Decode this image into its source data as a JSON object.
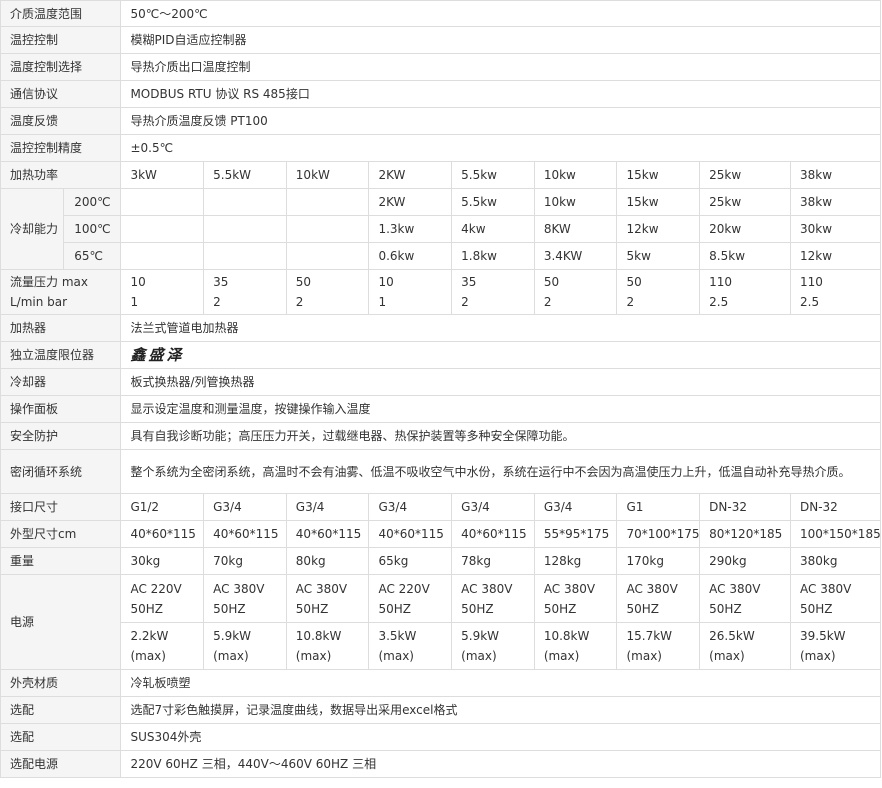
{
  "rows": [
    {
      "label": "介质温度范围",
      "value": "50℃～200℃"
    },
    {
      "label": "温控控制",
      "value": "模糊PID自适应控制器"
    },
    {
      "label": "温度控制选择",
      "value": "导热介质出口温度控制"
    },
    {
      "label": "通信协议",
      "value": "MODBUS RTU 协议  RS 485接口"
    },
    {
      "label": "温度反馈",
      "value": "导热介质温度反馈 PT100"
    },
    {
      "label": "温控控制精度",
      "value": "±0.5℃"
    }
  ],
  "heating_power": {
    "label": "加热功率",
    "values": [
      "3kW",
      "5.5kW",
      "10kW",
      "2KW",
      "5.5kw",
      "10kw",
      "15kw",
      "25kw",
      "38kw"
    ]
  },
  "cooling": {
    "label": "冷却能力",
    "rows": [
      {
        "temp": "200℃",
        "values": [
          "",
          "",
          "",
          "2KW",
          "5.5kw",
          "10kw",
          "15kw",
          "25kw",
          "38kw"
        ]
      },
      {
        "temp": "100℃",
        "values": [
          "",
          "",
          "",
          "1.3kw",
          "4kw",
          "8KW",
          "12kw",
          "20kw",
          "30kw"
        ]
      },
      {
        "temp": "65℃",
        "values": [
          "",
          "",
          "",
          "0.6kw",
          "1.8kw",
          "3.4KW",
          "5kw",
          "8.5kw",
          "12kw"
        ]
      }
    ]
  },
  "flow": {
    "label1": "流量压力 max",
    "label2": "L/min bar",
    "flow_values": [
      "10",
      "35",
      "50",
      "10",
      "35",
      "50",
      "50",
      "110",
      "110"
    ],
    "pressure_values": [
      "1",
      "2",
      "2",
      "1",
      "2",
      "2",
      "2",
      "2.5",
      "2.5"
    ]
  },
  "rows2": [
    {
      "label": "加热器",
      "value": "法兰式管道电加热器"
    },
    {
      "label": "独立温度限位器",
      "value": "鑫盛泽"
    },
    {
      "label": "冷却器",
      "value": "板式换热器/列管换热器"
    },
    {
      "label": "操作面板",
      "value": "显示设定温度和测量温度，按键操作输入温度"
    },
    {
      "label": "安全防护",
      "value": "具有自我诊断功能；高压压力开关，过载继电器、热保护装置等多种安全保障功能。"
    },
    {
      "label": "密闭循环系统",
      "value": "整个系统为全密闭系统，高温时不会有油雾、低温不吸收空气中水份，系统在运行中不会因为高温使压力上升，低温自动补充导热介质。"
    }
  ],
  "port_size": {
    "label": "接口尺寸",
    "values": [
      "G1/2",
      "G3/4",
      "G3/4",
      "G3/4",
      "G3/4",
      "G3/4",
      "G1",
      "DN-32",
      "DN-32"
    ]
  },
  "dimensions": {
    "label": "外型尺寸cm",
    "values": [
      "40*60*115",
      "40*60*115",
      "40*60*115",
      "40*60*115",
      "40*60*115",
      "55*95*175",
      "70*100*175",
      "80*120*185",
      "100*150*185"
    ]
  },
  "weight": {
    "label": "重量",
    "values": [
      "30kg",
      "70kg",
      "80kg",
      "65kg",
      "78kg",
      "128kg",
      "170kg",
      "290kg",
      "380kg"
    ]
  },
  "power": {
    "label": "电源",
    "voltage": [
      "AC 220V",
      "AC 380V",
      "AC 380V",
      "AC 220V",
      "AC 380V",
      "AC 380V",
      "AC 380V",
      "AC 380V",
      "AC 380V"
    ],
    "frequency": [
      "50HZ",
      "50HZ",
      "50HZ",
      "50HZ",
      "50HZ",
      "50HZ",
      "50HZ",
      "50HZ",
      "50HZ"
    ],
    "max_power": [
      "2.2kW",
      "5.9kW",
      "10.8kW",
      "3.5kW",
      "5.9kW",
      "10.8kW",
      "15.7kW",
      "26.5kW",
      "39.5kW"
    ],
    "max_label": "(max)"
  },
  "rows3": [
    {
      "label": "外壳材质",
      "value": "冷轧板喷塑"
    },
    {
      "label": "选配",
      "value": "选配7寸彩色触摸屏，记录温度曲线，数据导出采用excel格式"
    },
    {
      "label": "选配",
      "value": "SUS304外壳"
    },
    {
      "label": "选配电源",
      "value": "220V 60HZ 三相，440V～460V 60HZ 三相"
    }
  ]
}
